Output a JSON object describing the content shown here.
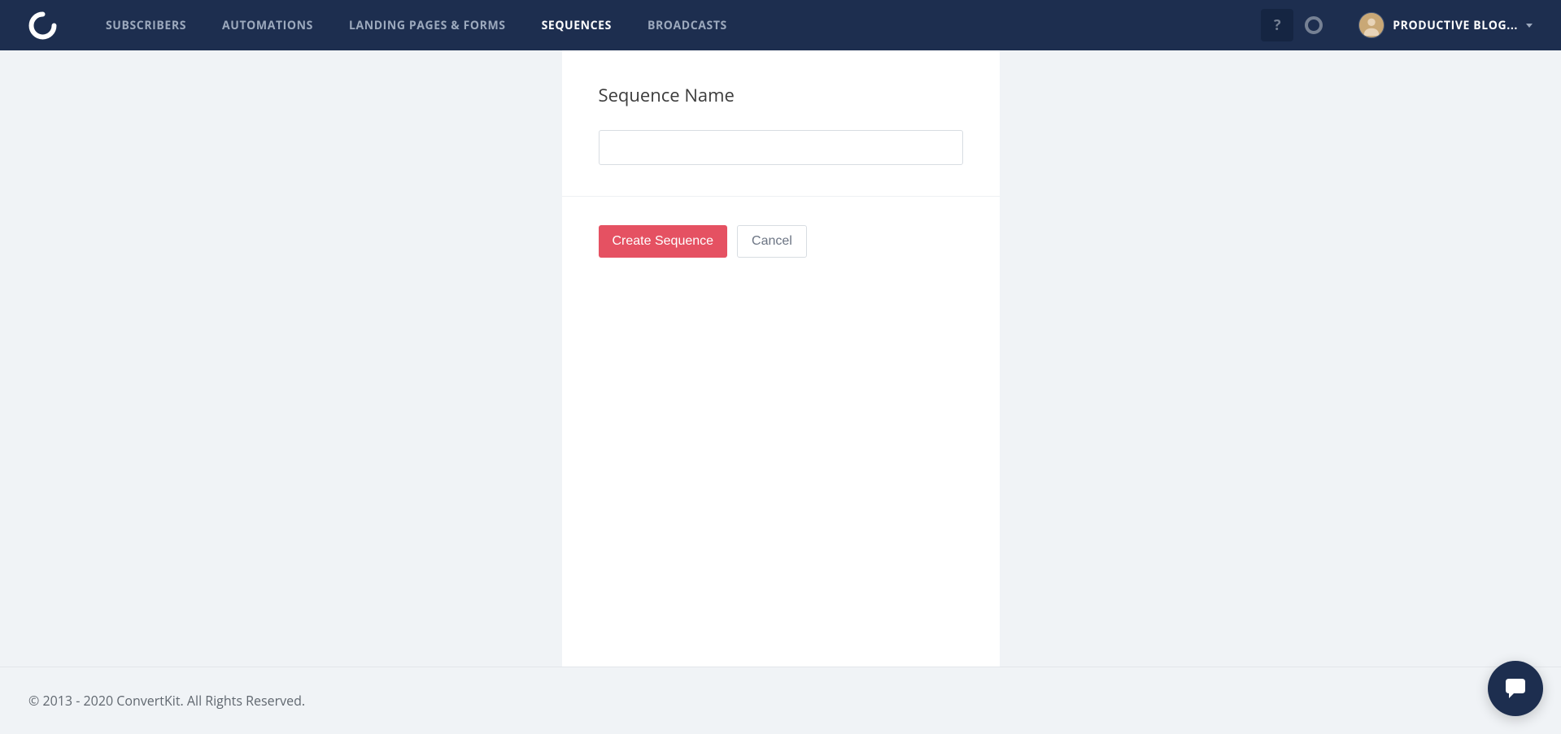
{
  "nav": {
    "items": [
      {
        "label": "SUBSCRIBERS",
        "active": false
      },
      {
        "label": "AUTOMATIONS",
        "active": false
      },
      {
        "label": "LANDING PAGES & FORMS",
        "active": false
      },
      {
        "label": "SEQUENCES",
        "active": true
      },
      {
        "label": "BROADCASTS",
        "active": false
      }
    ],
    "help_label": "?",
    "user_name": "PRODUCTIVE BLOG..."
  },
  "form": {
    "title": "Sequence Name",
    "input_value": "",
    "create_label": "Create Sequence",
    "cancel_label": "Cancel"
  },
  "footer": {
    "copyright": "© 2013 - 2020 ConvertKit. All Rights Reserved."
  }
}
